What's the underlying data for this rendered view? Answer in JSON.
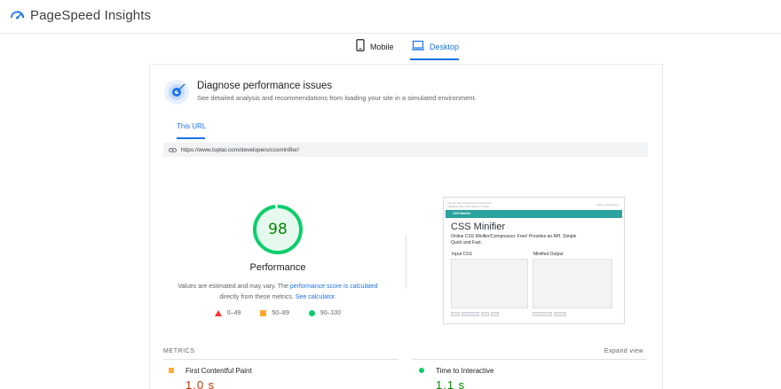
{
  "app": {
    "title": "PageSpeed Insights",
    "icon": "pagespeed-logo-icon",
    "brand_colors": {
      "blue": "#4285f4",
      "dark_blue": "#1a73e8"
    }
  },
  "tabs": [
    {
      "label": "Mobile",
      "icon": "phone-icon",
      "selected": false
    },
    {
      "label": "Desktop",
      "icon": "laptop-icon",
      "selected": true
    }
  ],
  "diagnose": {
    "icon": "diagnose-target-icon",
    "title": "Diagnose performance issues",
    "subtitle": "See detailed analysis and recommendations from loading your site in a simulated environment."
  },
  "url_section": {
    "tab_label": "This URL",
    "link_icon": "link-icon",
    "url": "https://www.toptal.com/developers/cssminifier/"
  },
  "performance": {
    "score": "98",
    "score_fraction": 0.98,
    "score_color": "#0cce6b",
    "label": "Performance",
    "note_prefix": "Values are estimated and may vary. The ",
    "note_link1": "performance score is calculated",
    "note_middle": " directly from these metrics. ",
    "note_link2": "See calculator."
  },
  "legend": [
    {
      "range": "0–49",
      "shape": "triangle",
      "color": "#ff3333"
    },
    {
      "range": "50–89",
      "shape": "square",
      "color": "#ffaa33"
    },
    {
      "range": "90–100",
      "shape": "circle",
      "color": "#0cce6b"
    }
  ],
  "screenshot": {
    "top_text": "The top free resources for developers\nfreelance with a few clicks in Toptal",
    "top_right": "Refer a Developer",
    "nav_title": "CSS Minifier",
    "page_title": "CSS Minifier",
    "description": "Online CSS Minifier/Compressor. Free! Provides an API. Simple Quick and Fast.",
    "input_label": "Input CSS",
    "output_label": "Minified Output",
    "nav_color": "#2aa29e"
  },
  "metrics": {
    "heading": "METRICS",
    "expand_label": "Expand view",
    "items": [
      {
        "name": "First Contentful Paint",
        "value": "1.0 s",
        "status": "average",
        "color": "#c33300"
      },
      {
        "name": "Time to Interactive",
        "value": "1.1 s",
        "status": "good",
        "color": "#008800"
      }
    ]
  }
}
